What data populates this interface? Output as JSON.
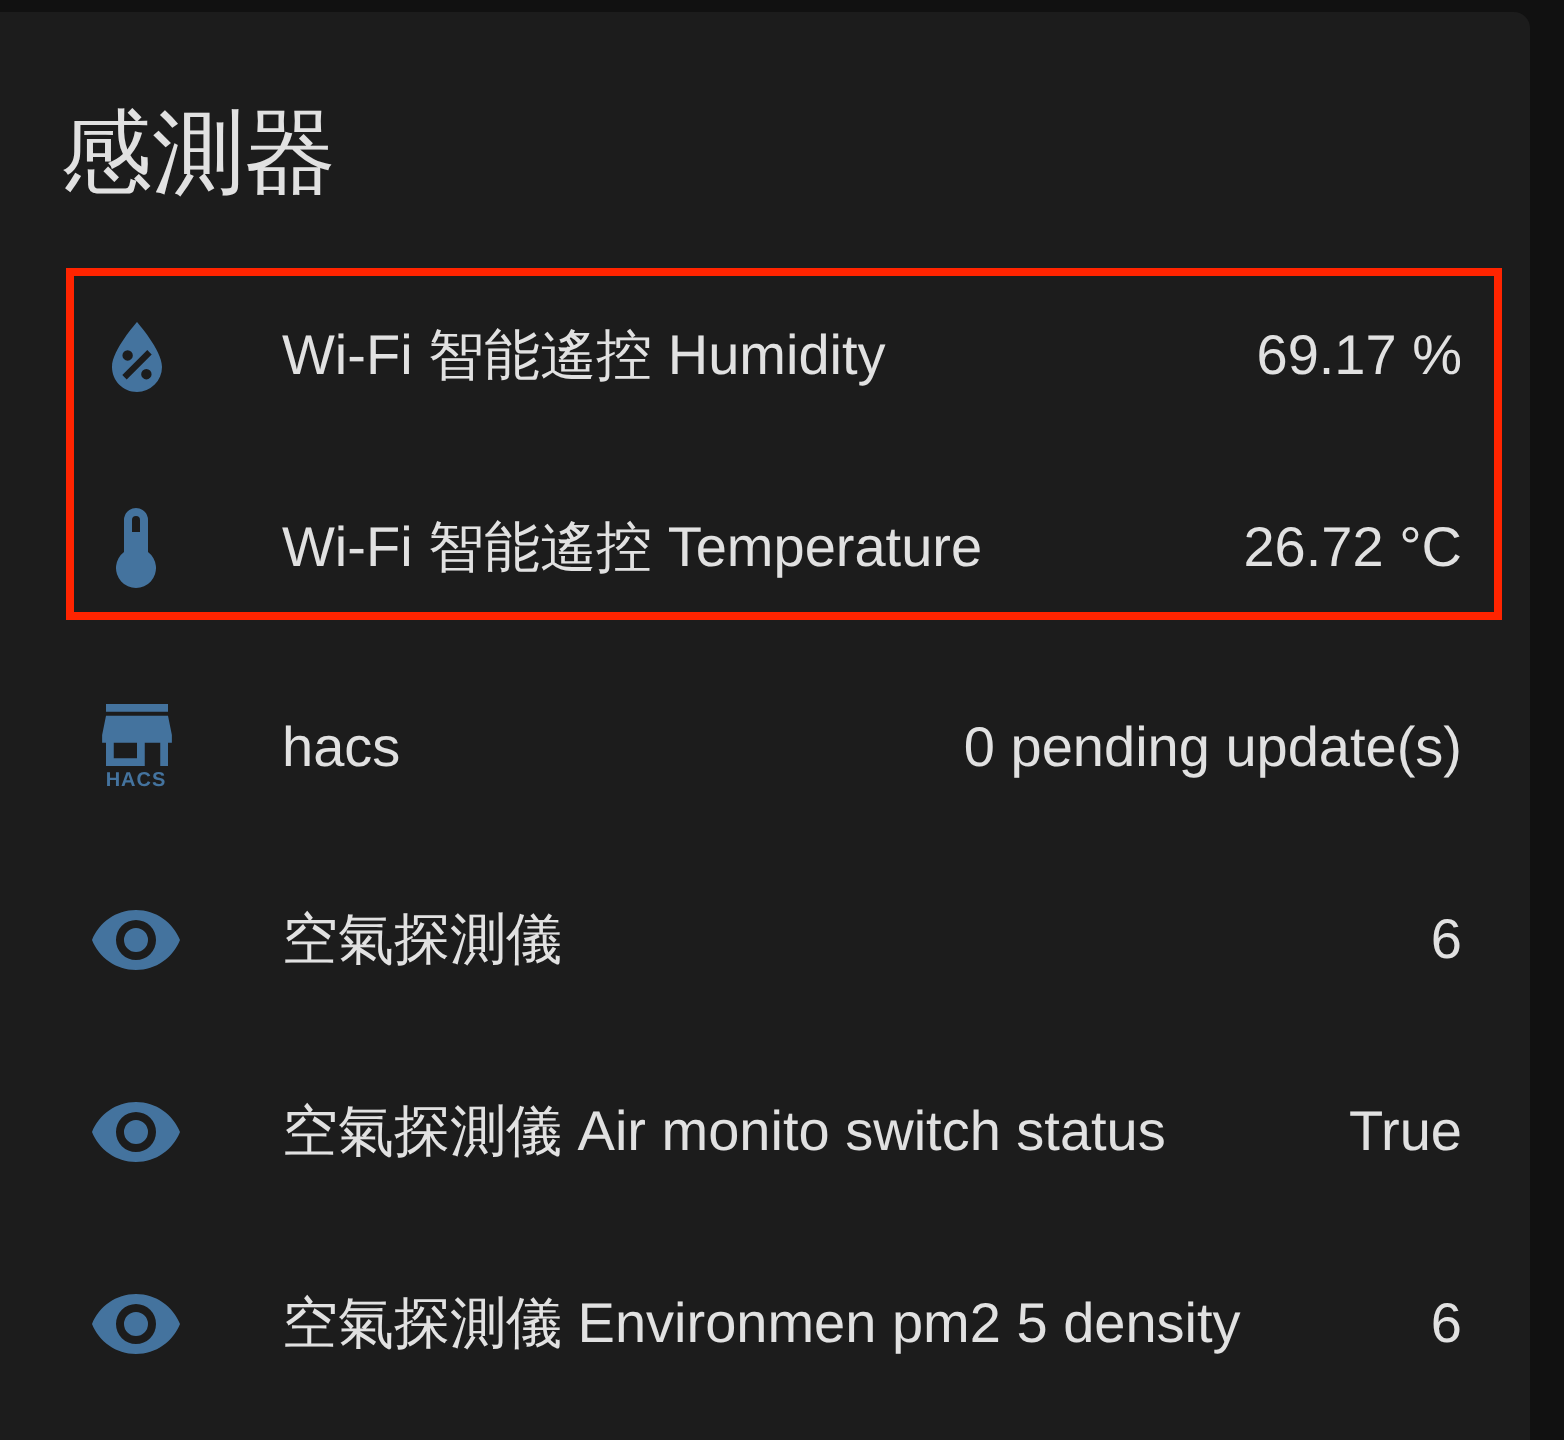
{
  "card": {
    "title": "感測器"
  },
  "entities": [
    {
      "kind": "humidity",
      "name": "Wi-Fi 智能遙控 Humidity",
      "state": "69.17 %",
      "highlighted": true
    },
    {
      "kind": "temperature",
      "name": "Wi-Fi 智能遙控 Temperature",
      "state": "26.72 °C",
      "highlighted": true
    },
    {
      "kind": "store",
      "icon_caption": "HACS",
      "name": "hacs",
      "state": "0 pending update(s)",
      "highlighted": false
    },
    {
      "kind": "generic",
      "name": "空氣探測儀",
      "state": "6",
      "highlighted": false
    },
    {
      "kind": "generic",
      "name": "空氣探測儀 Air monito switch status",
      "state": "True",
      "highlighted": false
    },
    {
      "kind": "generic",
      "name": "空氣探測儀 Environmen pm2 5 density",
      "state": "6",
      "highlighted": false
    }
  ]
}
